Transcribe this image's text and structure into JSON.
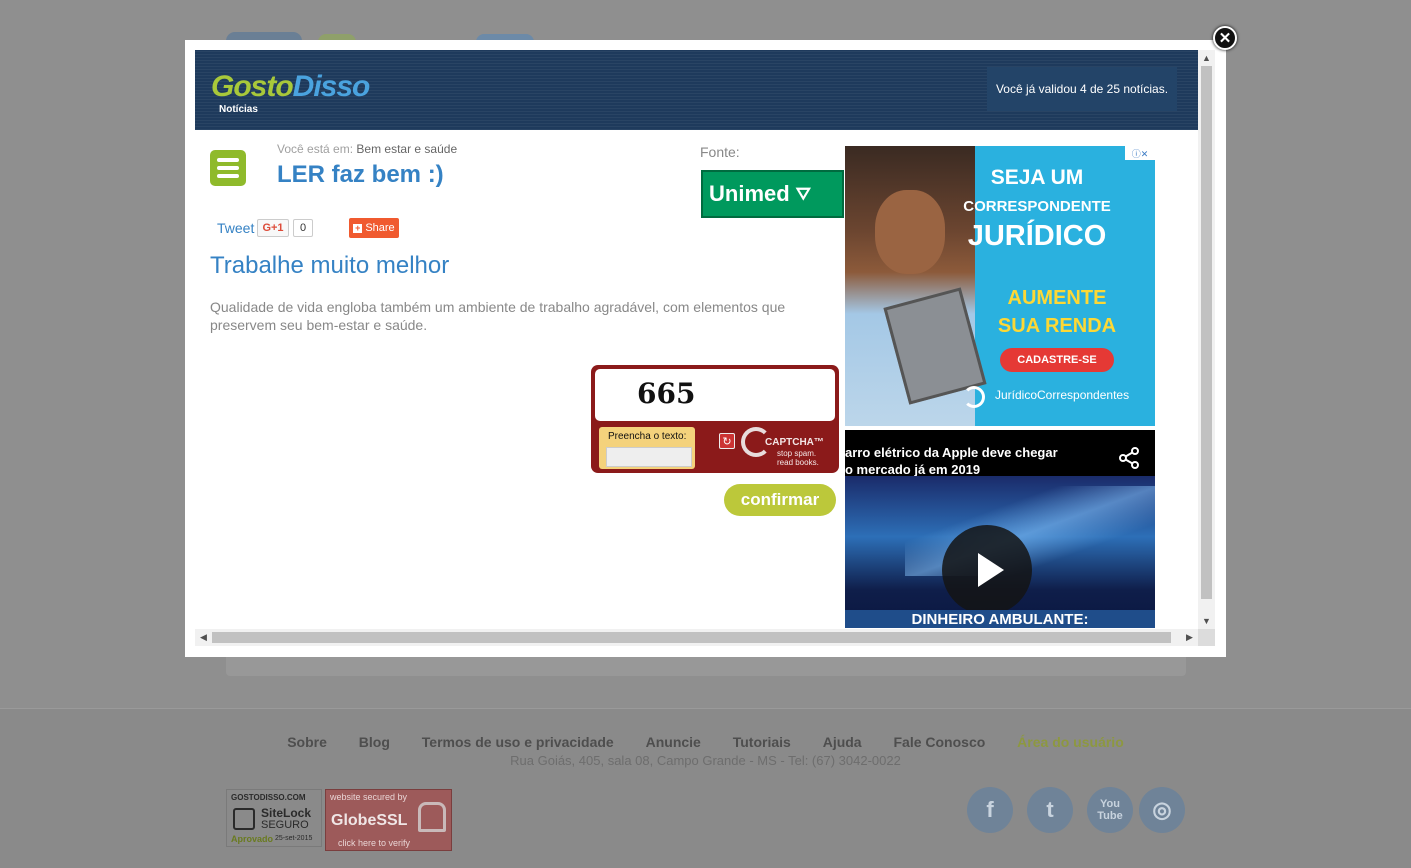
{
  "header": {
    "logo_part1": "Gosto",
    "logo_part2": "Disso",
    "logo_subtitle": "Notícias",
    "validated_text": "Você já validou 4 de 25 notícias."
  },
  "article": {
    "breadcrumb_prefix": "Você está em:",
    "breadcrumb_category": "Bem estar e saúde",
    "title": "LER faz bem :)",
    "source_label": "Fonte:",
    "source_logo_text": "Unimed",
    "subtitle": "Trabalhe muito melhor",
    "description": "Qualidade de vida engloba também um ambiente de trabalho agradável, com elementos que preservem seu bem-estar e saúde."
  },
  "social_buttons": {
    "tweet": "Tweet",
    "gplus": "G+1",
    "gplus_count": "0",
    "share": "Share"
  },
  "captcha": {
    "code": "665",
    "label": "Preencha o texto:",
    "input_value": "",
    "logo_text": "CAPTCHA™",
    "logo_tagline_1": "stop spam.",
    "logo_tagline_2": "read books."
  },
  "confirm_label": "confirmar",
  "ad_top": {
    "line1": "SEJA UM",
    "line2": "CORRESPONDENTE",
    "line3": "JURÍDICO",
    "line4a": "AUMENTE",
    "line4b": "SUA RENDA",
    "cta": "CADASTRE-SE",
    "brand": "JurídicoCorrespondentes",
    "adchoices": "ⓘ✕"
  },
  "ad_video": {
    "headline_1": "arro elétrico da Apple deve chegar",
    "headline_2": "o mercado já em 2019",
    "banner": "DINHEIRO AMBULANTE:"
  },
  "footer": {
    "links": [
      "Sobre",
      "Blog",
      "Termos de uso e privacidade",
      "Anuncie",
      "Tutoriais",
      "Ajuda",
      "Fale Conosco",
      "Área do usuário"
    ],
    "address": "Rua Goiás, 405, sala 08, Campo Grande - MS - Tel: (67) 3042-0022",
    "sitelock_site": "GOSTODISSO.COM",
    "sitelock_brand": "SiteLock",
    "sitelock_status": "SEGURO",
    "sitelock_approved": "Aprovado",
    "sitelock_date": "25-set-2015",
    "ssl_top": "website secured by",
    "ssl_brand": "GlobeSSL",
    "ssl_bottom": "click here to verify",
    "social": [
      "f",
      "t",
      "You Tube",
      "◎"
    ]
  },
  "colors": {
    "header_bg": "#1e3a5c",
    "accent_blue": "#3582c4",
    "menu_green": "#8fba2b",
    "confirm_green": "#bcc83a",
    "captcha_red": "#8b1a1a",
    "ad_blue": "#2ab1df"
  }
}
